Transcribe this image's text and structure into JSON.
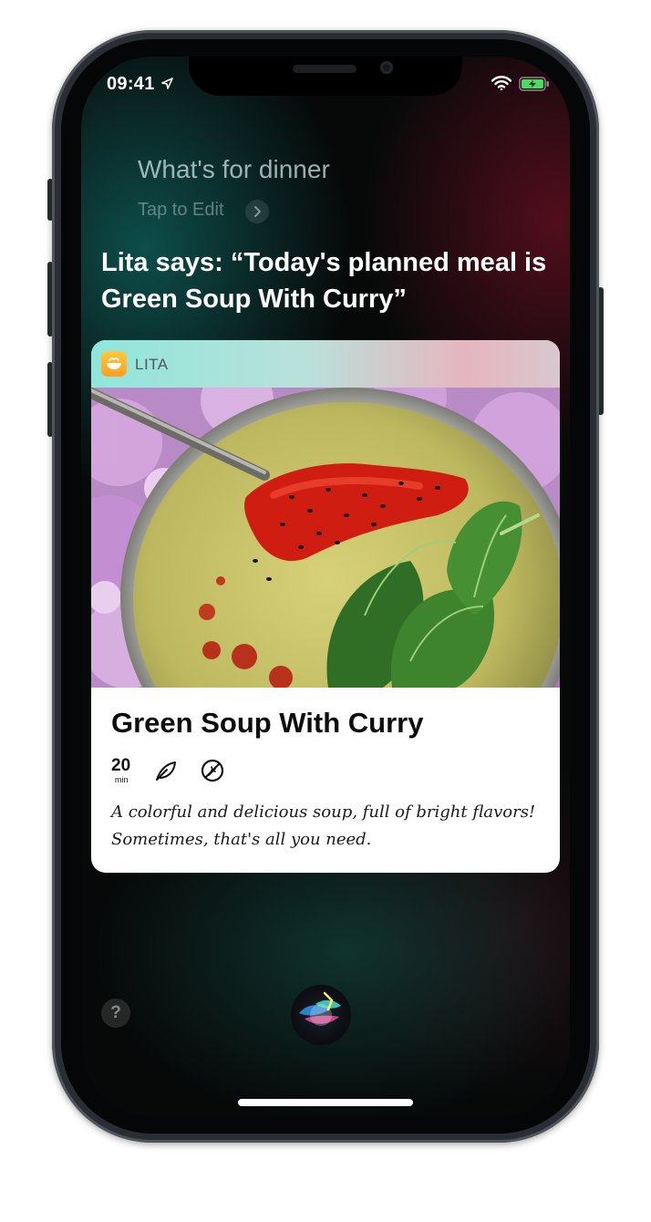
{
  "status_bar": {
    "time": "09:41"
  },
  "siri": {
    "query": "What's for dinner",
    "tap_to_edit": "Tap to Edit",
    "response": "Lita says: “Today's planned meal is Green Soup With Curry”"
  },
  "card": {
    "app_name": "LITA",
    "title": "Green Soup With Curry",
    "time_value": "20",
    "time_unit": "min",
    "description": "A colorful and delicious soup, full of bright flavors! Sometimes, that's all you need."
  },
  "help_label": "?",
  "icons": [
    "location-arrow-icon",
    "wifi-icon",
    "battery-charging-icon",
    "chevron-right-icon",
    "bowl-app-icon",
    "leaf-icon",
    "no-gluten-icon",
    "siri-icon"
  ]
}
